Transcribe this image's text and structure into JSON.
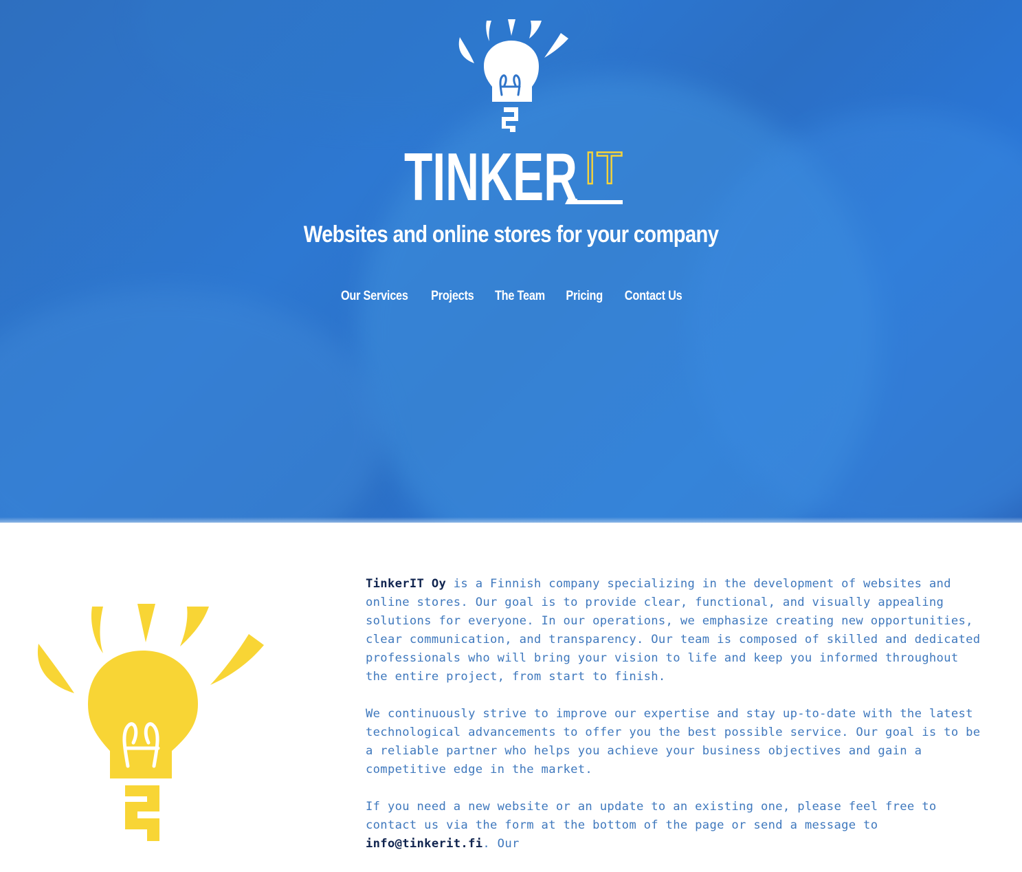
{
  "brand": {
    "wordmark_main": "TINKER",
    "wordmark_accent": "IT",
    "accent_color": "#f6d33a",
    "hero_color": "#2b73cc",
    "text_dark": "#10244f",
    "text_body": "#3f78bd"
  },
  "hero": {
    "tagline": "Websites and online stores for your company"
  },
  "nav": {
    "items": [
      {
        "label": "Our Services"
      },
      {
        "label": "Projects"
      },
      {
        "label": "The Team"
      },
      {
        "label": "Pricing"
      },
      {
        "label": "Contact Us"
      }
    ]
  },
  "about": {
    "p1_company": "TinkerIT Oy",
    "p1_text": " is a Finnish company specializing in the development of websites and online stores. Our goal is to provide clear, functional, and visually appealing solutions for everyone. In our operations, we emphasize creating new opportunities, clear communication, and transparency. Our team is composed of skilled and dedicated professionals who will bring your vision to life and keep you informed throughout the entire project, from start to finish.",
    "p2_text": "We continuously strive to improve our expertise and stay up-to-date with the latest technological advancements to offer you the best possible service. Our goal is to be a reliable partner who helps you achieve your business objectives and gain a competitive edge in the market.",
    "p3_text_before": "If you need a new website or an update to an existing one, please feel free to contact us via the form at the bottom of the page or send a message to ",
    "p3_email": "info@tinkerit.fi",
    "p3_text_after": ". Our"
  },
  "icons": {
    "hero_logo": "lightbulb-logo-icon",
    "about_logo": "lightbulb-icon"
  }
}
